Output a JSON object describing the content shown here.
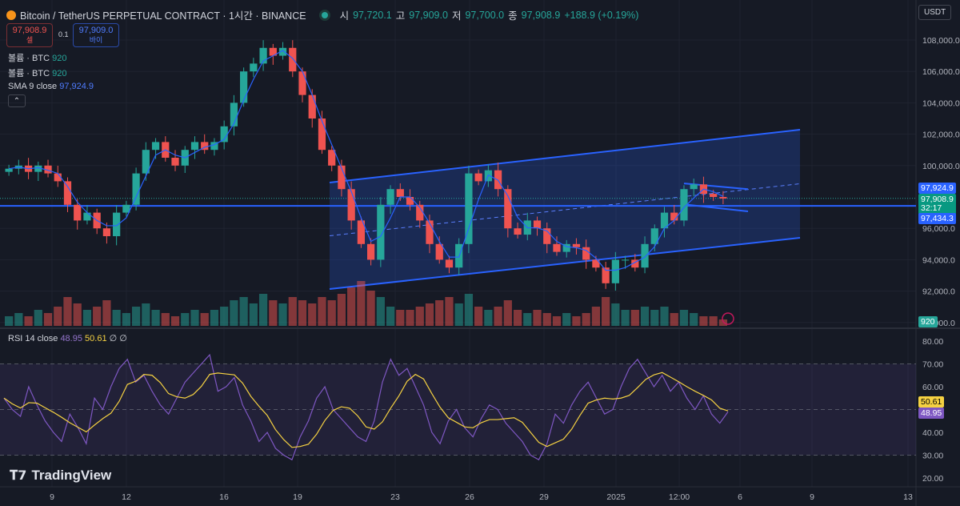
{
  "header": {
    "title": "Bitcoin / TetherUS PERPETUAL CONTRACT · 1시간 · BINANCE",
    "o_label": "시",
    "open": "97,720.1",
    "h_label": "고",
    "high": "97,909.0",
    "l_label": "저",
    "low": "97,700.0",
    "c_label": "종",
    "close": "97,908.9",
    "change": "+188.9 (+0.19%)"
  },
  "trade": {
    "sell_price": "97,908.9",
    "sell_label": "셀",
    "spread": "0.1",
    "buy_price": "97,909.0",
    "buy_label": "바이"
  },
  "legend": [
    {
      "name": "볼륨 · BTC",
      "value": "920"
    },
    {
      "name": "볼륨 · BTC",
      "value": "920"
    },
    {
      "name": "SMA 9 close",
      "value": "97,924.9"
    }
  ],
  "rsi_legend": {
    "name": "RSI 14 close",
    "rsi": "48.95",
    "ma": "50.61",
    "extra": "∅ ∅"
  },
  "currency": "USDT",
  "collapse_icon": "chevron-up-icon",
  "brand": "TradingView",
  "tags": {
    "sma": "97,924.9",
    "last": "97,908.9",
    "countdown": "32:17",
    "hline": "97,434.3",
    "volume": "920",
    "rsi_ma": "50.61",
    "rsi": "48.95"
  },
  "colors": {
    "up": "#26a69a",
    "down": "#ef5350",
    "accent": "#2962ff",
    "rsi": "#7e57c2",
    "rsi_ma": "#f5d142"
  },
  "chart_data": {
    "type": "candlestick",
    "price_axis": {
      "ticks": [
        "108,000.0",
        "106,000.0",
        "104,000.0",
        "102,000.0",
        "100,000.0",
        "96,000.0",
        "94,000.0",
        "92,000.0",
        "90,000.0"
      ],
      "tick_values": [
        108000,
        106000,
        104000,
        102000,
        100000,
        96000,
        94000,
        92000,
        90000
      ]
    },
    "time_axis": [
      "9",
      "12",
      "16",
      "19",
      "23",
      "26",
      "29",
      "2025",
      "12:00",
      "6",
      "9",
      "13"
    ],
    "closes": [
      99800,
      100000,
      99600,
      100000,
      99500,
      99000,
      97500,
      96500,
      97000,
      96000,
      95500,
      97000,
      97500,
      99500,
      101000,
      101500,
      100500,
      100000,
      101000,
      101500,
      101000,
      101500,
      102500,
      104000,
      106000,
      106500,
      107500,
      107000,
      107500,
      106000,
      104500,
      103000,
      101000,
      100000,
      98500,
      96500,
      95000,
      94000,
      97500,
      98500,
      98000,
      97500,
      96500,
      95000,
      94000,
      93500,
      95000,
      99500,
      99000,
      99700,
      98500,
      96000,
      95600,
      96500,
      96000,
      95000,
      94500,
      95000,
      94800,
      94000,
      93500,
      92500,
      94000,
      94000,
      93500,
      95000,
      96000,
      97000,
      96500,
      98500,
      98800,
      98200,
      98000,
      97900
    ],
    "volumes": [
      3,
      4,
      3,
      5,
      4,
      6,
      9,
      7,
      5,
      6,
      8,
      5,
      4,
      6,
      7,
      5,
      4,
      3,
      4,
      5,
      4,
      5,
      6,
      8,
      9,
      7,
      10,
      8,
      7,
      9,
      8,
      7,
      9,
      8,
      10,
      12,
      14,
      11,
      9,
      6,
      5,
      5,
      6,
      7,
      8,
      9,
      7,
      10,
      6,
      5,
      6,
      8,
      5,
      4,
      5,
      4,
      3,
      4,
      3,
      4,
      6,
      9,
      7,
      5,
      5,
      6,
      5,
      6,
      4,
      5,
      4,
      3,
      3,
      2
    ],
    "channel": {
      "upper": [
        98918,
        102286
      ],
      "lower": [
        92133,
        95398
      ]
    },
    "horizontal_line": 97434.3,
    "wedge": {
      "upper": [
        98860,
        98500
      ],
      "lower": [
        97530,
        97080
      ]
    },
    "rsi": {
      "axis": [
        "80.00",
        "70.00",
        "60.00",
        "40.00",
        "30.00",
        "20.00"
      ],
      "axis_values": [
        80,
        70,
        60,
        40,
        30,
        20
      ],
      "band": [
        30,
        70
      ],
      "values": [
        55,
        50,
        47,
        60,
        52,
        45,
        40,
        36,
        48,
        42,
        35,
        55,
        50,
        60,
        68,
        72,
        62,
        65,
        58,
        52,
        48,
        55,
        62,
        66,
        70,
        74,
        58,
        60,
        64,
        52,
        45,
        36,
        40,
        33,
        30,
        28,
        38,
        45,
        55,
        60,
        50,
        46,
        42,
        38,
        36,
        45,
        62,
        72,
        65,
        68,
        60,
        52,
        40,
        35,
        45,
        50,
        42,
        38,
        46,
        52,
        50,
        44,
        40,
        36,
        30,
        28,
        35,
        48,
        44,
        52,
        58,
        62,
        55,
        48,
        50,
        60,
        68,
        72,
        66,
        60,
        65,
        58,
        62,
        55,
        50,
        56,
        48,
        44,
        49
      ]
    }
  }
}
